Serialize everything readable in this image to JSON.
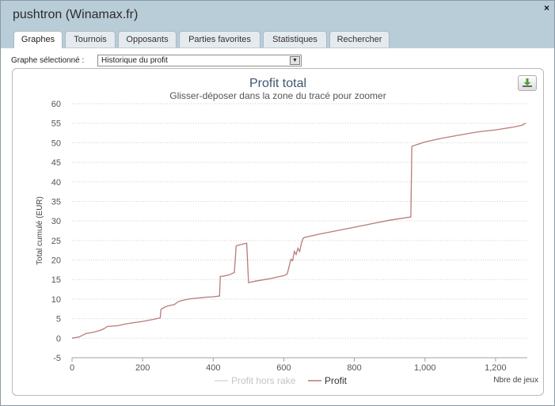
{
  "window": {
    "title": "pushtron (Winamax.fr)",
    "close_label": "×"
  },
  "tabs": [
    {
      "label": "Graphes",
      "active": true
    },
    {
      "label": "Tournois"
    },
    {
      "label": "Opposants"
    },
    {
      "label": "Parties favorites"
    },
    {
      "label": "Statistiques"
    },
    {
      "label": "Rechercher"
    }
  ],
  "graph_select": {
    "label": "Graphe sélectionné :",
    "value": "Historique du profit"
  },
  "download_icon": "download-icon",
  "colors": {
    "profit": "#b97a7a",
    "profit_hors_rake": "#d8d8d8",
    "title": "#3e576f"
  },
  "chart_data": {
    "type": "line",
    "title": "Profit total",
    "subtitle": "Glisser-déposer dans la zone du tracé pour zoomer",
    "xlabel": "Nbre de jeux",
    "ylabel": "Total cumulé (EUR)",
    "xlim": [
      0,
      1290
    ],
    "ylim": [
      -5,
      60
    ],
    "x_ticks": [
      0,
      200,
      400,
      600,
      800,
      1000,
      1200
    ],
    "x_tick_labels": [
      "0",
      "200",
      "400",
      "600",
      "800",
      "1,000",
      "1,200"
    ],
    "y_ticks": [
      -5,
      0,
      5,
      10,
      15,
      20,
      25,
      30,
      35,
      40,
      45,
      50,
      55,
      60
    ],
    "y_tick_labels": [
      "-5",
      "0",
      "5",
      "10",
      "15",
      "20",
      "25",
      "30",
      "35",
      "40",
      "45",
      "50",
      "55",
      "60"
    ],
    "grid": true,
    "legend_position": "bottom",
    "series": [
      {
        "name": "Profit hors rake",
        "visible": false,
        "x": [],
        "y": []
      },
      {
        "name": "Profit",
        "x": [
          0,
          20,
          30,
          40,
          60,
          80,
          90,
          100,
          130,
          150,
          170,
          200,
          230,
          250,
          252,
          260,
          270,
          290,
          300,
          310,
          330,
          350,
          380,
          400,
          418,
          420,
          430,
          445,
          450,
          460,
          465,
          480,
          490,
          495,
          500,
          520,
          560,
          590,
          600,
          605,
          610,
          620,
          625,
          630,
          635,
          640,
          645,
          650,
          655,
          660,
          700,
          750,
          800,
          850,
          900,
          960,
          963,
          966,
          980,
          1000,
          1050,
          1100,
          1150,
          1200,
          1250,
          1275,
          1285
        ],
        "y": [
          0,
          0.3,
          0.8,
          1.2,
          1.5,
          2,
          2.4,
          3,
          3.2,
          3.6,
          3.9,
          4.3,
          4.8,
          5.2,
          7.4,
          7.8,
          8.2,
          8.6,
          9.3,
          9.6,
          10,
          10.2,
          10.5,
          10.6,
          10.8,
          15.8,
          15.9,
          16.2,
          16.4,
          16.8,
          23.6,
          24,
          24.2,
          24.3,
          14.2,
          14.6,
          15.2,
          15.8,
          16,
          16.2,
          16.5,
          20.2,
          19.8,
          22.2,
          21.4,
          23,
          22.2,
          24.3,
          25.6,
          25.8,
          26.6,
          27.5,
          28.4,
          29.3,
          30.2,
          31,
          49,
          49.2,
          49.6,
          50.2,
          51.2,
          52,
          52.8,
          53.3,
          54,
          54.5,
          55
        ]
      }
    ]
  }
}
